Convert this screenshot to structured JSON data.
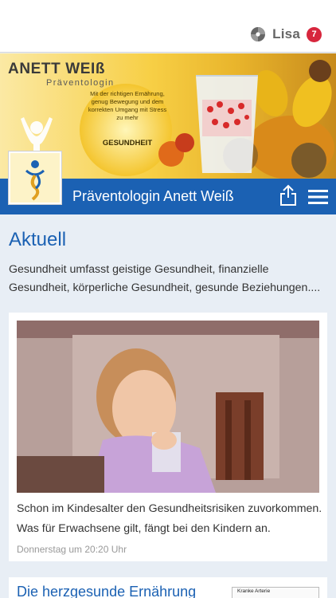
{
  "topbar": {
    "user_name": "Lisa",
    "notification_count": "7",
    "user_icon": "app-logo-icon"
  },
  "banner": {
    "brand_name": "ANETT WEIß",
    "brand_subtitle": "Präventologin",
    "tagline": "Mit der richtigen Ernährung, genug Bewegung und dem korrekten Umgang mit Stress zu mehr",
    "tagline_emphasis": "GESUNDHEIT"
  },
  "titlebar": {
    "site_title": "Präventologin Anett Weiß",
    "share_icon": "share-icon",
    "menu_icon": "hamburger-menu-icon"
  },
  "main": {
    "section_title": "Aktuell",
    "intro": "Gesundheit umfasst geistige Gesundheit, finanzielle Gesundheit, körperliche Gesundheit, gesunde Beziehungen....",
    "posts": [
      {
        "text": "Schon im Kindesalter den Gesundheitsrisiken zuvorkommen. Was für Erwachsene gilt, fängt bei den Kindern an.",
        "date": "Donnerstag um 20:20 Uhr"
      },
      {
        "title": "Die herzgesunde Ernährung",
        "thumb_label": "Kranke Arterie"
      }
    ]
  },
  "colors": {
    "accent_blue": "#1b61b3",
    "badge_red": "#d7263d",
    "background": "#e8eef5"
  }
}
